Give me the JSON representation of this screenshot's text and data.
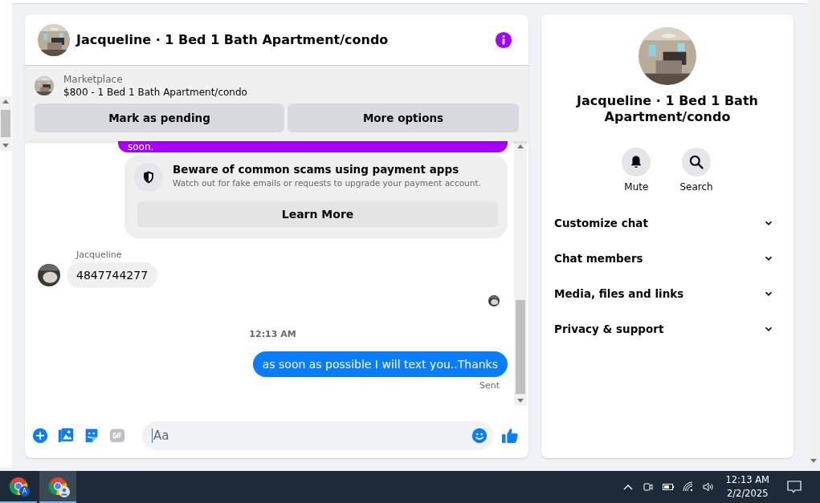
{
  "chat": {
    "title": "Jacqueline · 1 Bed 1 Bath Apartment/condo",
    "listing": {
      "label": "Marketplace",
      "title": "$800 - 1 Bed 1 Bath Apartment/condo",
      "buttons": [
        "Mark as pending",
        "More options"
      ]
    },
    "messages": [
      {
        "kind": "outgoing",
        "text": "soon.",
        "color": "#a800ff"
      },
      {
        "kind": "notice",
        "title": "Beware of common scams using payment apps",
        "text": "Watch out for fake emails or requests to upgrade your payment account.",
        "button": "Learn More"
      },
      {
        "kind": "incoming",
        "sender": "Jacqueline",
        "text": "4847744277"
      },
      {
        "kind": "seen"
      },
      {
        "kind": "time",
        "text": "12:13 AM"
      },
      {
        "kind": "outgoing",
        "text": "as soon as possible I will text you..Thanks",
        "color": "#0a7cff",
        "status": "Sent"
      }
    ],
    "composer": {
      "placeholder": "Aa"
    }
  },
  "info_panel": {
    "title": "Jacqueline · 1 Bed 1 Bath Apartment/condo",
    "actions": [
      {
        "kind": "mute",
        "label": "Mute"
      },
      {
        "kind": "search",
        "label": "Search"
      }
    ],
    "sections": [
      {
        "label": "Customize chat",
        "expanded": false
      },
      {
        "label": "Chat members",
        "expanded": false
      },
      {
        "label": "Media, files and links",
        "expanded": false
      },
      {
        "label": "Privacy & support",
        "expanded": false
      }
    ]
  },
  "taskbar": {
    "apps": [
      {
        "badge": "A",
        "selected": false
      },
      {
        "selected": true
      }
    ],
    "time": "12:13 AM",
    "date": "2/2/2025"
  }
}
